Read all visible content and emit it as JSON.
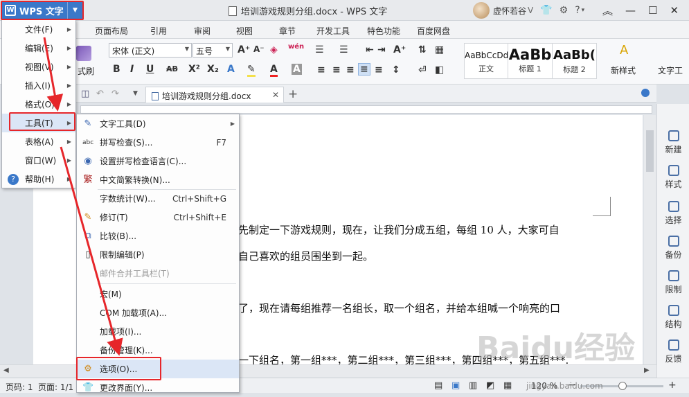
{
  "app": {
    "wps_button": "WPS 文字",
    "window_title": "培训游戏规则分组.docx - WPS 文字",
    "user_name": "虚怀若谷",
    "user_caret": "V"
  },
  "ribbon_tabs": [
    "页面布局",
    "引用",
    "审阅",
    "视图",
    "章节",
    "开发工具",
    "特色功能",
    "百度网盘"
  ],
  "ribbon": {
    "brush_label": "式刷",
    "font_name": "宋体 (正文)",
    "font_size": "五号",
    "styles": [
      {
        "preview": "AaBbCcDd",
        "label": "正文"
      },
      {
        "preview": "AaBb",
        "label": "标题 1"
      },
      {
        "preview": "AaBb(",
        "label": "标题 2"
      }
    ],
    "new_style": "新样式",
    "text_tools": "文字工"
  },
  "doc_tab": {
    "title": "培训游戏规则分组.docx"
  },
  "document": {
    "lines": [
      "先制定一下游戏规则，现在，让我们分成五组，每组 10 人，大家可自",
      "自己喜欢的组员围坐到一起。",
      "了，现在请每组推荐一名组长，取一个组名，并给本组喊一个响亮的口",
      "一下组名，第一组***，第二组***，第三组***，第四组***，第五组***."
    ]
  },
  "main_menu": [
    {
      "label": "文件(F)",
      "submenu": true
    },
    {
      "label": "编辑(E)",
      "submenu": true
    },
    {
      "label": "视图(V)",
      "submenu": true
    },
    {
      "label": "插入(I)",
      "submenu": true
    },
    {
      "label": "格式(O)",
      "submenu": true
    },
    {
      "label": "工具(T)",
      "submenu": true
    },
    {
      "label": "表格(A)",
      "submenu": true
    },
    {
      "label": "窗口(W)",
      "submenu": true
    },
    {
      "label": "帮助(H)",
      "submenu": true
    }
  ],
  "tools_menu": [
    {
      "label": "文字工具(D)",
      "shortcut": "",
      "submenu": true
    },
    {
      "label": "拼写检查(S)...",
      "shortcut": "F7"
    },
    {
      "label": "设置拼写检查语言(C)...",
      "shortcut": ""
    },
    {
      "label": "中文简繁转换(N)...",
      "shortcut": ""
    },
    {
      "label": "字数统计(W)...",
      "shortcut": "Ctrl+Shift+G"
    },
    {
      "label": "修订(T)",
      "shortcut": "Ctrl+Shift+E"
    },
    {
      "label": "比较(B)...",
      "shortcut": ""
    },
    {
      "label": "限制编辑(P)",
      "shortcut": ""
    },
    {
      "label": "邮件合并工具栏(T)",
      "shortcut": "",
      "disabled": true
    },
    {
      "label": "宏(M)",
      "shortcut": ""
    },
    {
      "label": "COM 加载项(A)...",
      "shortcut": ""
    },
    {
      "label": "加载项(I)...",
      "shortcut": ""
    },
    {
      "label": "备份管理(K)...",
      "shortcut": ""
    },
    {
      "label": "选项(O)...",
      "shortcut": ""
    },
    {
      "label": "更改界面(Y)...",
      "shortcut": ""
    }
  ],
  "side_panel": [
    "新建",
    "样式",
    "选择",
    "备份",
    "限制",
    "结构",
    "反馈"
  ],
  "status": {
    "page_num": "页码: 1",
    "page_of": "页面: 1/1",
    "zoom": "120 %"
  },
  "watermark": "Baidu经验",
  "watermark_url": "jingyan.baidu.com",
  "colors": {
    "accent": "#3a78c9",
    "highlight": "#e6262a",
    "menu_hover": "#dbe6f6"
  }
}
